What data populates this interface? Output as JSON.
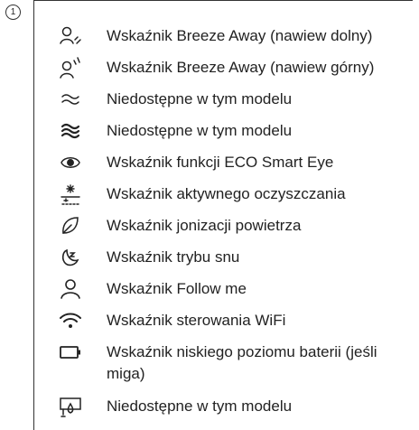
{
  "callout_number": "1",
  "items": [
    {
      "icon": "breeze-away-lower-icon",
      "label": "Wskaźnik Breeze Away (nawiew dolny)"
    },
    {
      "icon": "breeze-away-upper-icon",
      "label": "Wskaźnik Breeze Away (nawiew górny)"
    },
    {
      "icon": "wave-thin-icon",
      "label": "Niedostępne w tym modelu"
    },
    {
      "icon": "wave-bold-icon",
      "label": "Niedostępne w tym modelu"
    },
    {
      "icon": "eye-icon",
      "label": "Wskaźnik funkcji ECO Smart Eye"
    },
    {
      "icon": "active-cleaning-icon",
      "label": "Wskaźnik aktywnego oczyszczania"
    },
    {
      "icon": "leaf-icon",
      "label": "Wskaźnik jonizacji powietrza"
    },
    {
      "icon": "sleep-mode-icon",
      "label": "Wskaźnik trybu snu"
    },
    {
      "icon": "person-icon",
      "label": "Wskaźnik Follow me"
    },
    {
      "icon": "wifi-icon",
      "label": "Wskaźnik sterowania WiFi"
    },
    {
      "icon": "battery-icon",
      "label": "Wskaźnik niskiego poziomu baterii (jeśli miga)"
    },
    {
      "icon": "drip-tray-icon",
      "label": "Niedostępne w tym modelu"
    }
  ]
}
